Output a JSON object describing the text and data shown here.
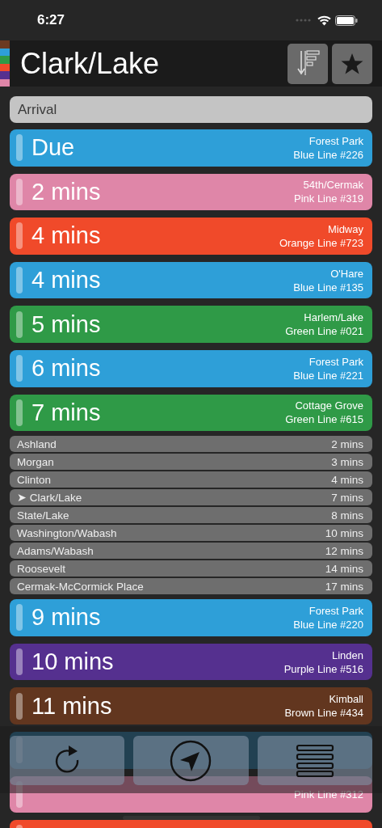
{
  "status_bar": {
    "time": "6:27"
  },
  "header": {
    "title": "Clark/Lake",
    "line_colors": [
      {
        "color": "#6b3a22"
      },
      {
        "color": "#2e9fd8"
      },
      {
        "color": "#2f9a47"
      },
      {
        "color": "#f04a2a"
      },
      {
        "color": "#55308f"
      },
      {
        "color": "#df86a8"
      }
    ]
  },
  "sort_label": "Arrival",
  "arrivals": [
    {
      "kind": "train",
      "time": "Due",
      "destination": "Forest Park",
      "run": "Blue Line #226",
      "color": "#2e9fd8"
    },
    {
      "kind": "train",
      "time": "2 mins",
      "destination": "54th/Cermak",
      "run": "Pink Line #319",
      "color": "#df86a8"
    },
    {
      "kind": "train",
      "time": "4 mins",
      "destination": "Midway",
      "run": "Orange Line #723",
      "color": "#f04a2a"
    },
    {
      "kind": "train",
      "time": "4 mins",
      "destination": "O'Hare",
      "run": "Blue Line #135",
      "color": "#2e9fd8"
    },
    {
      "kind": "train",
      "time": "5 mins",
      "destination": "Harlem/Lake",
      "run": "Green Line #021",
      "color": "#2f9a47"
    },
    {
      "kind": "train",
      "time": "6 mins",
      "destination": "Forest Park",
      "run": "Blue Line #221",
      "color": "#2e9fd8"
    },
    {
      "kind": "train",
      "time": "7 mins",
      "destination": "Cottage Grove",
      "run": "Green Line #615",
      "color": "#2f9a47"
    },
    {
      "kind": "stops",
      "stops": [
        {
          "name": "Ashland",
          "eta": "2 mins"
        },
        {
          "name": "Morgan",
          "eta": "3 mins"
        },
        {
          "name": "Clinton",
          "eta": "4 mins"
        },
        {
          "name": "➤ Clark/Lake",
          "eta": "7 mins"
        },
        {
          "name": "State/Lake",
          "eta": "8 mins"
        },
        {
          "name": "Washington/Wabash",
          "eta": "10 mins"
        },
        {
          "name": "Adams/Wabash",
          "eta": "12 mins"
        },
        {
          "name": "Roosevelt",
          "eta": "14 mins"
        },
        {
          "name": "Cermak-McCormick Place",
          "eta": "17 mins"
        }
      ]
    },
    {
      "kind": "train",
      "time": "9 mins",
      "destination": "Forest Park",
      "run": "Blue Line #220",
      "color": "#2e9fd8"
    },
    {
      "kind": "train",
      "time": "10 mins",
      "destination": "Linden",
      "run": "Purple Line #516",
      "color": "#55308f"
    },
    {
      "kind": "train",
      "time": "11 mins",
      "destination": "Kimball",
      "run": "Brown Line #434",
      "color": "#62361f"
    },
    {
      "kind": "covered"
    },
    {
      "kind": "train",
      "run": "Pink Line #312",
      "color": "#df86a8"
    },
    {
      "kind": "train",
      "color": "#f04a2a"
    }
  ]
}
